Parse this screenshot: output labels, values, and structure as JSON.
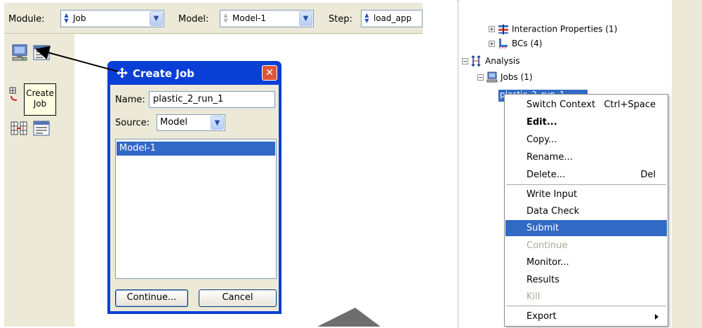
{
  "toolbar": {
    "module_label": "Module:",
    "module_value": "Job",
    "model_label": "Model:",
    "model_value": "Model-1",
    "step_label": "Step:",
    "step_value": "load_app"
  },
  "tooltip": {
    "line1": "Create",
    "line2": "Job"
  },
  "create_job_dialog": {
    "title": "Create Job",
    "close_glyph": "✕",
    "name_label": "Name:",
    "name_value": "plastic_2_run_1",
    "source_label": "Source:",
    "source_value": "Model",
    "models": [
      "Model-1"
    ],
    "continue_label": "Continue...",
    "cancel_label": "Cancel"
  },
  "model_tree": {
    "interaction_properties": "Interaction Properties (1)",
    "bcs": "BCs (4)",
    "analysis": "Analysis",
    "jobs": "Jobs (1)",
    "selected_job": "plastic_2_run_1"
  },
  "context_menu": {
    "items": [
      {
        "label": "Switch Context",
        "shortcut": "Ctrl+Space"
      },
      {
        "label": "Edit...",
        "bold": true
      },
      {
        "label": "Copy..."
      },
      {
        "label": "Rename..."
      },
      {
        "label": "Delete...",
        "shortcut": "Del"
      },
      {
        "label": "Write Input"
      },
      {
        "label": "Data Check"
      },
      {
        "label": "Submit",
        "selected": true
      },
      {
        "label": "Continue",
        "disabled": true
      },
      {
        "label": "Monitor..."
      },
      {
        "label": "Results"
      },
      {
        "label": "Kill",
        "disabled": true
      },
      {
        "label": "Export",
        "submenu": true
      }
    ]
  },
  "colors": {
    "xp_face": "#ece9d8",
    "xp_title_blue": "#0a3fd6",
    "selection_blue": "#316ac5",
    "close_red": "#e0553a"
  },
  "icons": {
    "create_job": "computer-monitor-icon",
    "job_manager": "job-manager-icon",
    "analysis": "analysis-icon",
    "jobs": "jobs-icon"
  }
}
